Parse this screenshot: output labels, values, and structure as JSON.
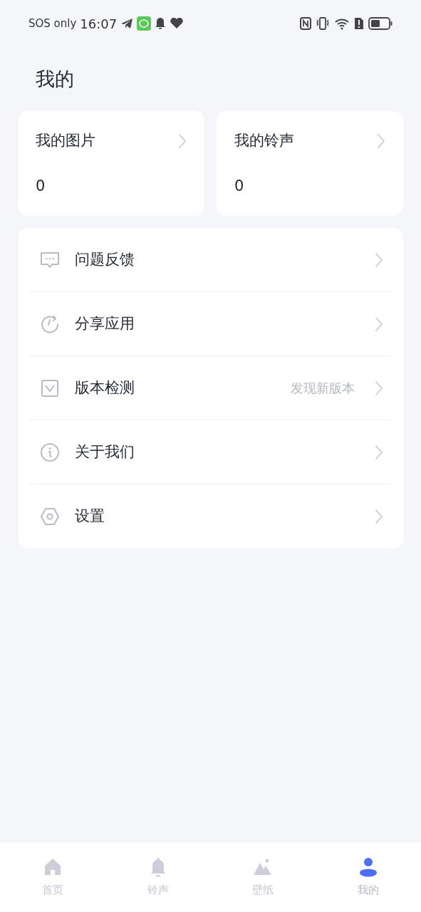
{
  "status_bar": {
    "carrier": "SOS only",
    "time": "16:07"
  },
  "title": "我的",
  "cards": [
    {
      "label": "我的图片",
      "count": "0"
    },
    {
      "label": "我的铃声",
      "count": "0"
    }
  ],
  "menu": [
    {
      "label": "问题反馈"
    },
    {
      "label": "分享应用"
    },
    {
      "label": "版本检测",
      "note": "发现新版本"
    },
    {
      "label": "关于我们"
    },
    {
      "label": "设置"
    }
  ],
  "tabs": [
    {
      "label": "首页",
      "selected": false
    },
    {
      "label": "铃声",
      "selected": false
    },
    {
      "label": "壁纸",
      "selected": false
    },
    {
      "label": "我的",
      "selected": true
    }
  ]
}
